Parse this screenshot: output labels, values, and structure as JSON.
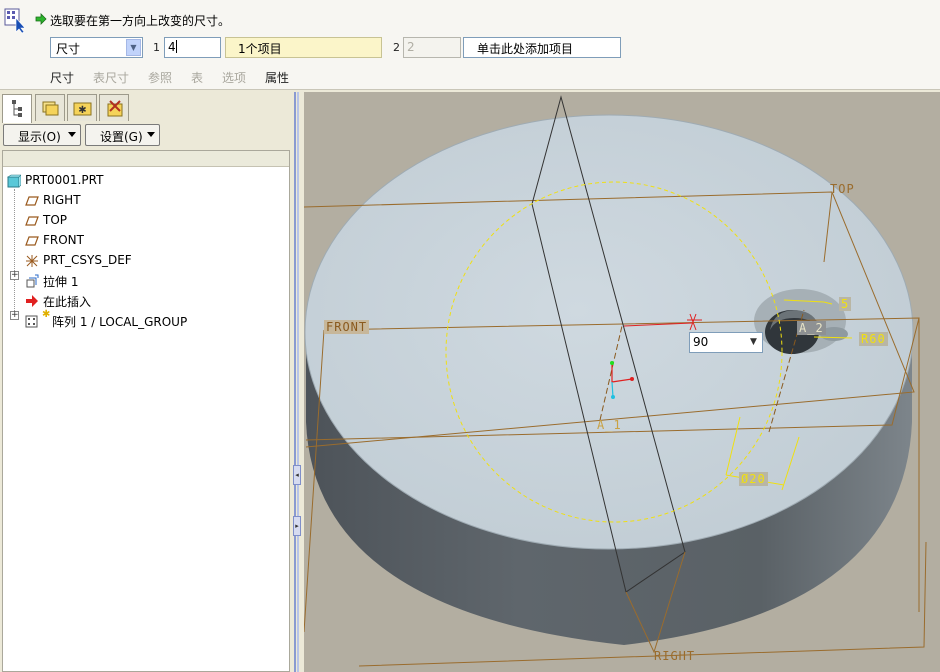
{
  "dashboard": {
    "prompt": "选取要在第一方向上改变的尺寸。",
    "dim_type_selected": "尺寸",
    "direction1_number": "1",
    "direction1_value": "4",
    "direction1_collector": "1个项目",
    "direction2_number": "2",
    "direction2_value": "2",
    "direction2_collector": "单击此处添加项目",
    "tabs": [
      "尺寸",
      "表尺寸",
      "参照",
      "表",
      "选项",
      "属性"
    ]
  },
  "navigator": {
    "show_label": "显示(O)",
    "settings_label": "设置(G)",
    "tree": {
      "root": "PRT0001.PRT",
      "items": [
        "RIGHT",
        "TOP",
        "FRONT",
        "PRT_CSYS_DEF",
        "拉伸 1",
        "在此插入",
        "阵列 1 / LOCAL_GROUP"
      ]
    }
  },
  "graphics": {
    "plane_labels": {
      "top": "TOP",
      "front": "FRONT",
      "right": "RIGHT"
    },
    "axis_labels": {
      "a1": "A_1",
      "a2": "A_2"
    },
    "dims": {
      "depth": "5",
      "radius": "R60",
      "diameter": "Ø20"
    },
    "dim_input_value": "90"
  },
  "colors": {
    "model_top": "#c7d2da",
    "model_side": "#5d6369",
    "background": "#b3aea1",
    "datum_plane": "#9a6c2d",
    "dimension": "#f0e010"
  }
}
